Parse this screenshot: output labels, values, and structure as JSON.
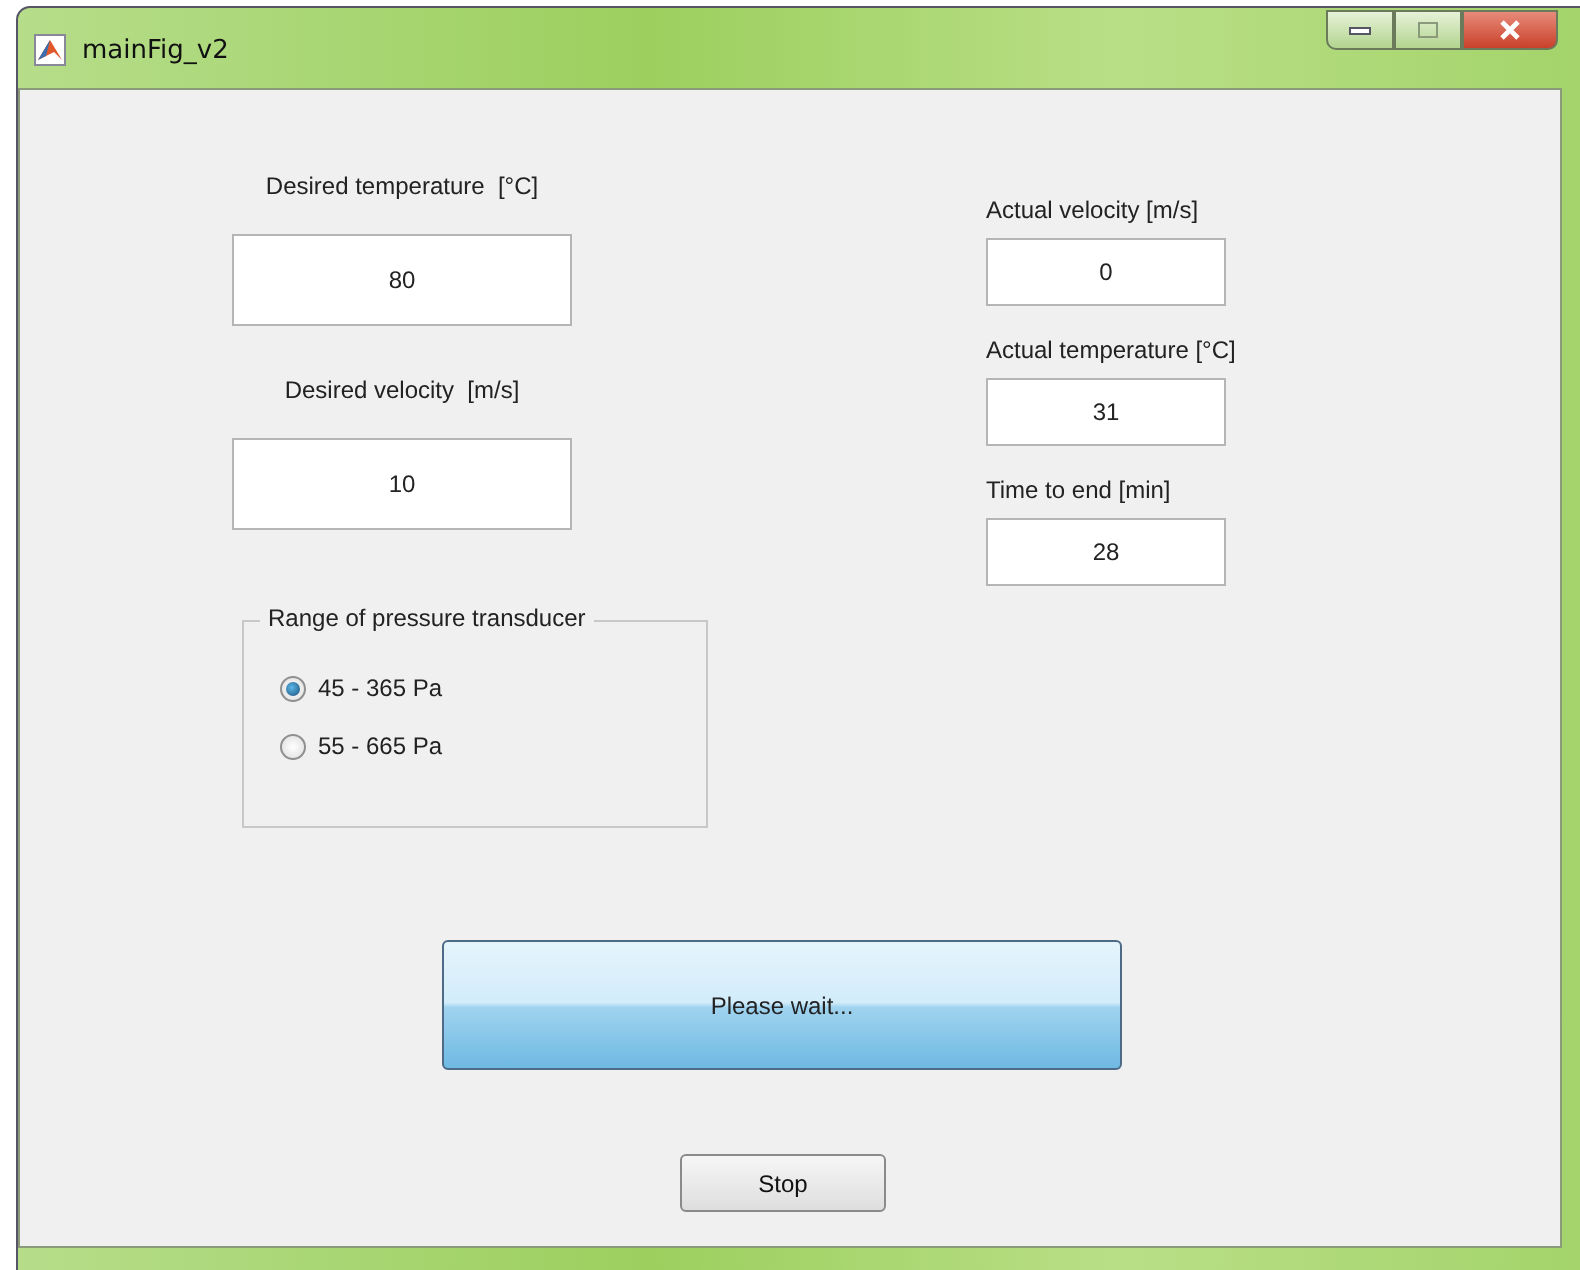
{
  "window": {
    "title": "mainFig_v2"
  },
  "desired_fields": [
    {
      "label": "Desired temperature  [°C]",
      "value": "80"
    },
    {
      "label": "Desired velocity  [m/s]",
      "value": "10"
    }
  ],
  "actual_fields": [
    {
      "label": "Actual velocity [m/s]",
      "value": "0"
    },
    {
      "label": "Actual temperature [°C]",
      "value": "31"
    },
    {
      "label": "Time to end [min]",
      "value": "28"
    }
  ],
  "pressure_range": {
    "title": "Range of pressure transducer",
    "options": [
      {
        "label": "45 - 365 Pa",
        "selected": true
      },
      {
        "label": "55 - 665 Pa",
        "selected": false
      }
    ]
  },
  "status_button": {
    "label": "Please wait..."
  },
  "stop_button": {
    "label": "Stop"
  }
}
